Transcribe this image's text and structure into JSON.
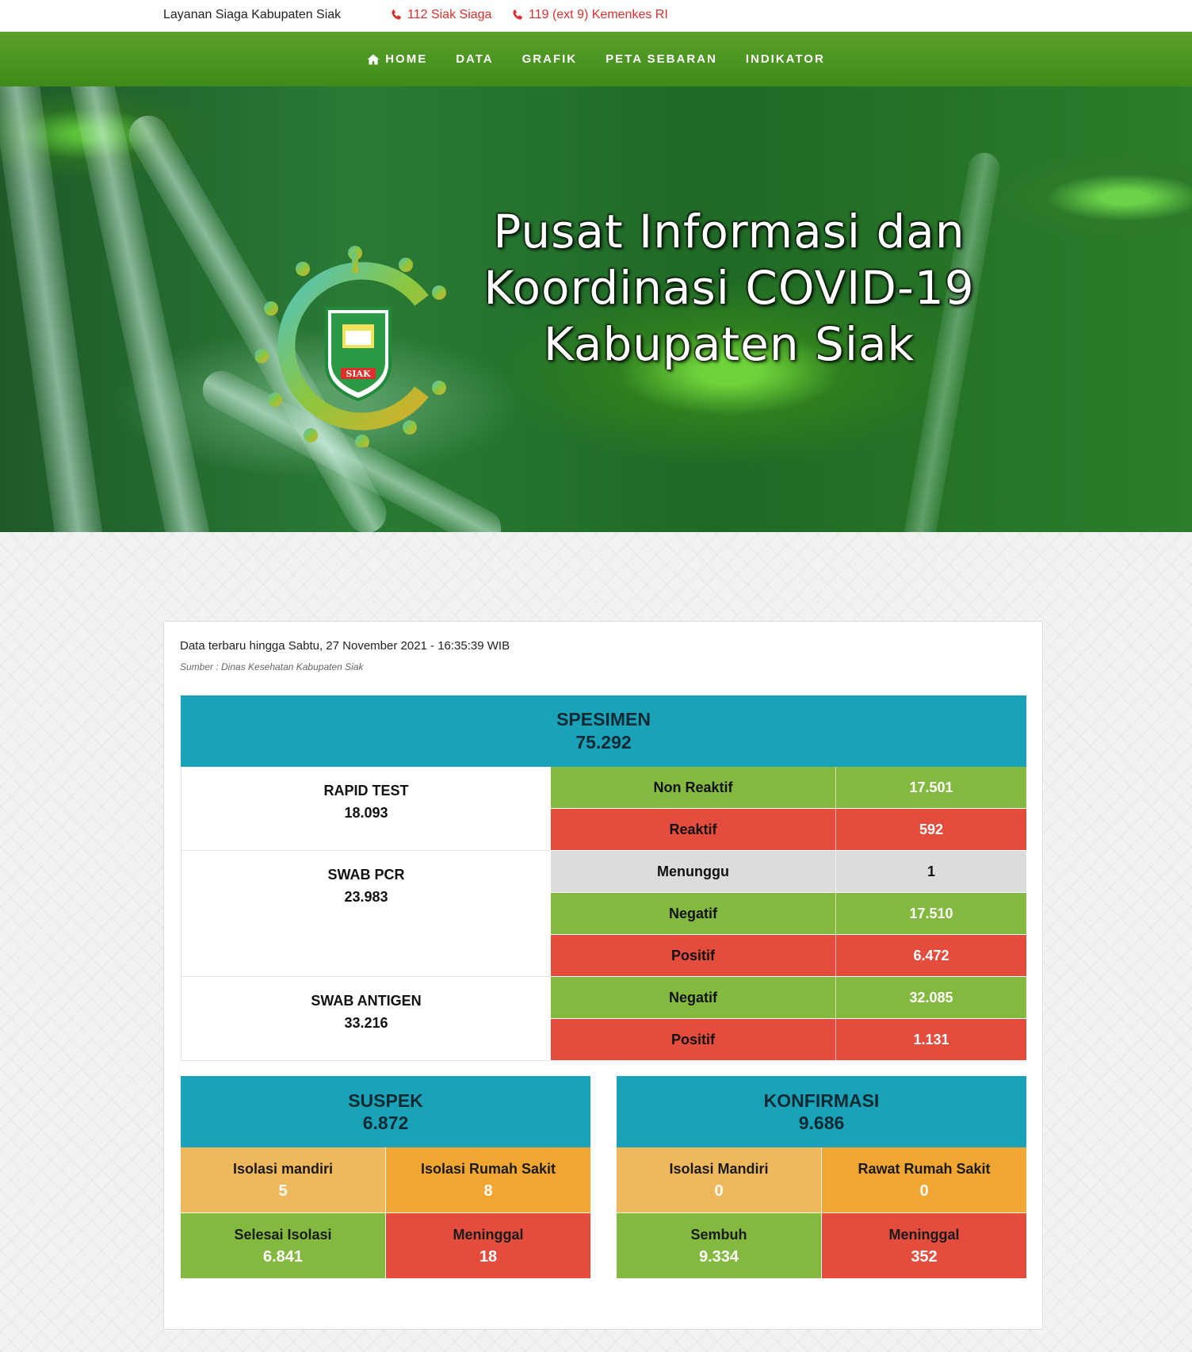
{
  "topbar": {
    "site_label": "Layanan Siaga Kabupaten Siak",
    "phone_1": "112 Siak Siaga",
    "phone_2": "119 (ext 9) Kemenkes RI"
  },
  "nav": {
    "items": [
      {
        "label": "HOME",
        "icon": "home-icon"
      },
      {
        "label": "DATA"
      },
      {
        "label": "GRAFIK"
      },
      {
        "label": "PETA SEBARAN"
      },
      {
        "label": "INDIKATOR"
      }
    ]
  },
  "hero": {
    "title_line_1": "Pusat Informasi dan",
    "title_line_2": "Koordinasi COVID-19",
    "title_line_3": "Kabupaten Siak",
    "logo_text": "SIAK"
  },
  "report": {
    "updated": "Data terbaru hingga Sabtu, 27 November 2021 - 16:35:39 WIB",
    "source": "Sumber : Dinas Kesehatan Kabupaten Siak"
  },
  "spesimen": {
    "title": "SPESIMEN",
    "total": "75.292",
    "groups": [
      {
        "name": "RAPID TEST",
        "total": "18.093",
        "rows": [
          {
            "label": "Non Reaktif",
            "value": "17.501",
            "status": "green"
          },
          {
            "label": "Reaktif",
            "value": "592",
            "status": "red"
          }
        ]
      },
      {
        "name": "SWAB PCR",
        "total": "23.983",
        "rows": [
          {
            "label": "Menunggu",
            "value": "1",
            "status": "grey"
          },
          {
            "label": "Negatif",
            "value": "17.510",
            "status": "green"
          },
          {
            "label": "Positif",
            "value": "6.472",
            "status": "red"
          }
        ]
      },
      {
        "name": "SWAB ANTIGEN",
        "total": "33.216",
        "rows": [
          {
            "label": "Negatif",
            "value": "32.085",
            "status": "green"
          },
          {
            "label": "Positif",
            "value": "1.131",
            "status": "red"
          }
        ]
      }
    ]
  },
  "suspek": {
    "title": "SUSPEK",
    "total": "6.872",
    "items": [
      {
        "label": "Isolasi mandiri",
        "value": "5"
      },
      {
        "label": "Isolasi Rumah Sakit",
        "value": "8"
      },
      {
        "label": "Selesai Isolasi",
        "value": "6.841"
      },
      {
        "label": "Meninggal",
        "value": "18"
      }
    ]
  },
  "konfirmasi": {
    "title": "KONFIRMASI",
    "total": "9.686",
    "items": [
      {
        "label": "Isolasi Mandiri",
        "value": "0"
      },
      {
        "label": "Rawat Rumah Sakit",
        "value": "0"
      },
      {
        "label": "Sembuh",
        "value": "9.334"
      },
      {
        "label": "Meninggal",
        "value": "352"
      }
    ]
  },
  "colors": {
    "nav_green": "#4a9423",
    "teal": "#1aa3b8",
    "green": "#82b93e",
    "red": "#e44d3d",
    "grey": "#dcdcdc",
    "orange_light": "#f0b85c",
    "orange": "#f1a632",
    "phone_red": "#d9302c"
  }
}
